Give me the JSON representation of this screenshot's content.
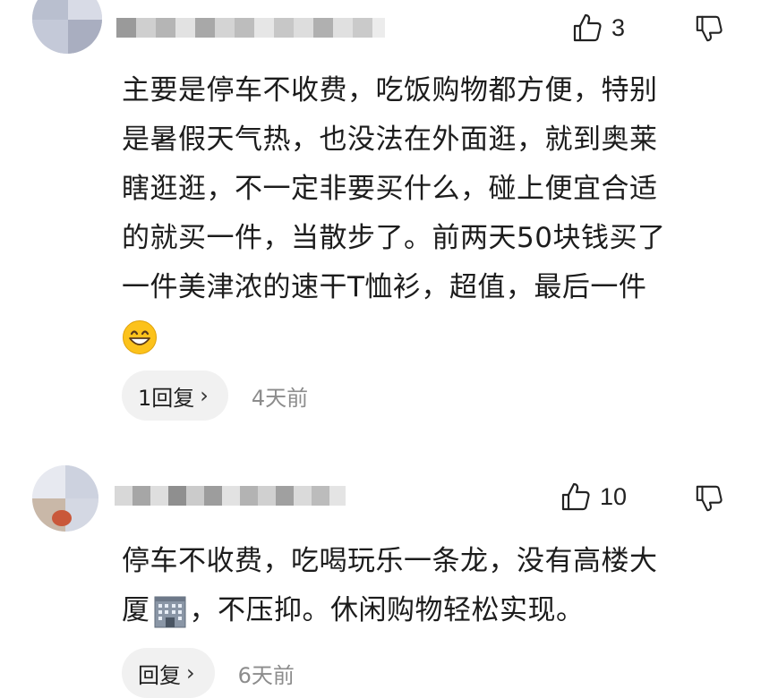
{
  "comments": [
    {
      "likes": "3",
      "text_lines": [
        "主要是停车不收费，吃饭购物都方便，特别",
        "是暑假天气热，也没法在外面逛，就到奥莱",
        "瞎逛逛，不一定非要买什么，碰上便宜合适",
        "的就买一件，当散步了。前两天50块钱买了",
        "一件美津浓的速干T恤衫，超值，最后一件"
      ],
      "emoji": "grinning-face-emoji",
      "reply_label": "1回复",
      "time": "4天前"
    },
    {
      "likes": "10",
      "text_line1": "停车不收费，吃喝玩乐一条龙，没有高楼大",
      "text_line2_a": "厦",
      "text_line2_b": "，不压抑。休闲购物轻松实现。",
      "emoji": "office-building-emoji",
      "reply_label": "回复",
      "time": "6天前"
    }
  ],
  "icons": {
    "like": "thumbs-up-icon",
    "dislike": "thumbs-down-icon",
    "chevron": "chevron-right-icon"
  },
  "colors": {
    "reply_pill_bg": "#f1f1f1",
    "time_text": "#8c8c8c",
    "text": "#1c1c1c"
  }
}
